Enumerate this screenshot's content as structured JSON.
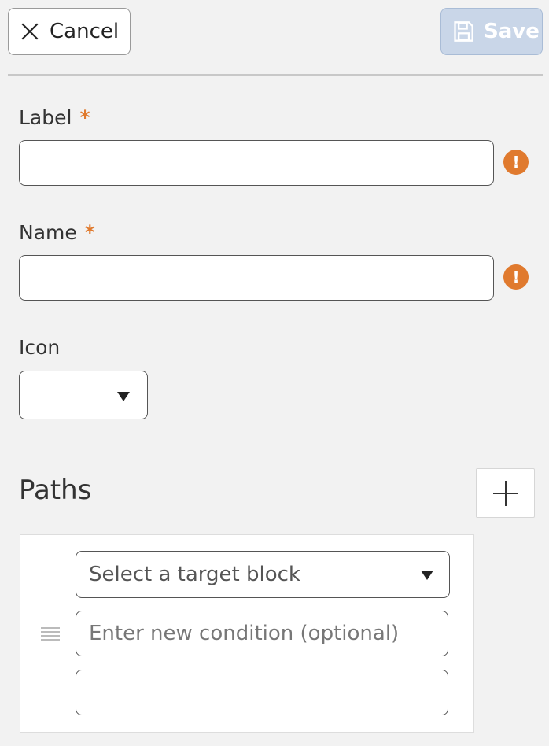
{
  "toolbar": {
    "cancel_label": "Cancel",
    "save_label": "Save"
  },
  "form": {
    "label_field": {
      "label": "Label",
      "required_mark": "*",
      "value": "",
      "warning": "!"
    },
    "name_field": {
      "label": "Name",
      "required_mark": "*",
      "value": "",
      "warning": "!"
    },
    "icon_field": {
      "label": "Icon",
      "selected": ""
    }
  },
  "paths": {
    "title": "Paths",
    "items": [
      {
        "target_placeholder": "Select a target block",
        "condition_placeholder": "Enter new condition (optional)",
        "condition_value": "",
        "extra_value": ""
      }
    ]
  },
  "colors": {
    "accent_warning": "#e07a2e",
    "save_disabled": "#c9d6e8",
    "background": "#f2f2f2"
  }
}
